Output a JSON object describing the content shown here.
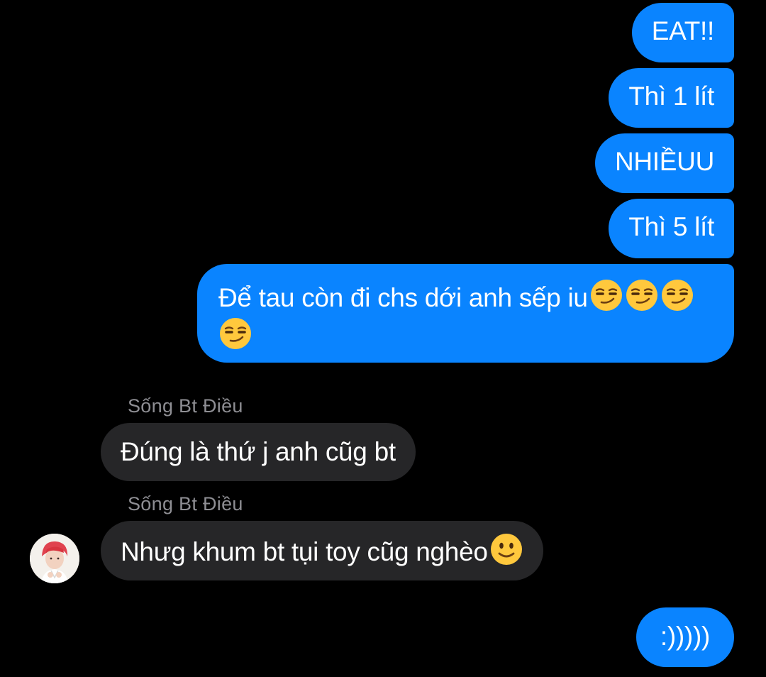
{
  "contact": {
    "name": "Sống Bt Điều"
  },
  "messages": [
    {
      "direction": "out",
      "text": "EAT!!"
    },
    {
      "direction": "out",
      "text": "Thì 1 lít"
    },
    {
      "direction": "out",
      "text": "NHIỀUU"
    },
    {
      "direction": "out",
      "text": "Thì 5 lít"
    },
    {
      "direction": "out",
      "text": "Để tau còn đi chs dới anh sếp iu",
      "emoji": [
        "smirking-face",
        "smirking-face",
        "smirking-face",
        "smirking-face"
      ]
    },
    {
      "direction": "in",
      "sender": "Sống Bt Điều",
      "text": "Đúng là thứ j anh cũg bt"
    },
    {
      "direction": "in",
      "sender": "Sống Bt Điều",
      "text": "Nhưg khum bt tụi toy cũg nghèo",
      "emoji": [
        "slightly-smiling-face"
      ]
    },
    {
      "direction": "out",
      "text": ":)))))"
    }
  ],
  "colors": {
    "background": "#000000",
    "outgoing_bubble": "#0a84ff",
    "incoming_bubble": "#262628",
    "sender_label": "#8e8e93",
    "emoji_yellow": "#ffc83d"
  }
}
